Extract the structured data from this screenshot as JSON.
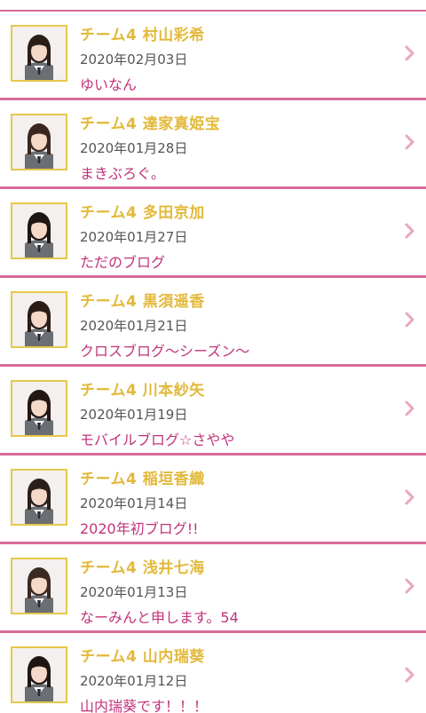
{
  "posts": [
    {
      "member": "チーム4 村山彩希",
      "date": "2020年02月03日",
      "title": "ゆいなん",
      "hair": "#2b1d18"
    },
    {
      "member": "チーム4 達家真姫宝",
      "date": "2020年01月28日",
      "title": "まきぶろぐ。",
      "hair": "#3a2720"
    },
    {
      "member": "チーム4 多田京加",
      "date": "2020年01月27日",
      "title": "ただのブログ",
      "hair": "#1e1614"
    },
    {
      "member": "チーム4 黒須遥香",
      "date": "2020年01月21日",
      "title": "クロスブログ〜シーズン〜",
      "hair": "#2a1c17"
    },
    {
      "member": "チーム4 川本紗矢",
      "date": "2020年01月19日",
      "title": "モバイルブログ☆さやや",
      "hair": "#231713"
    },
    {
      "member": "チーム4 稲垣香織",
      "date": "2020年01月14日",
      "title": "2020年初ブログ!!",
      "hair": "#2b1f1a"
    },
    {
      "member": "チーム4 浅井七海",
      "date": "2020年01月13日",
      "title": "なーみんと申します。54",
      "hair": "#3b2a22"
    },
    {
      "member": "チーム4 山内瑞葵",
      "date": "2020年01月12日",
      "title": "山内瑞葵です！！！",
      "hair": "#1f1512"
    }
  ],
  "colors": {
    "divider": "#d96a9a",
    "name": "#e3b93a",
    "title": "#c2337b",
    "date": "#555555",
    "thumb_border": "#e6c84a",
    "chevron": "#e9a6c4"
  },
  "icons": {
    "chevron": "chevron-right-icon",
    "photo": "member-photo"
  }
}
